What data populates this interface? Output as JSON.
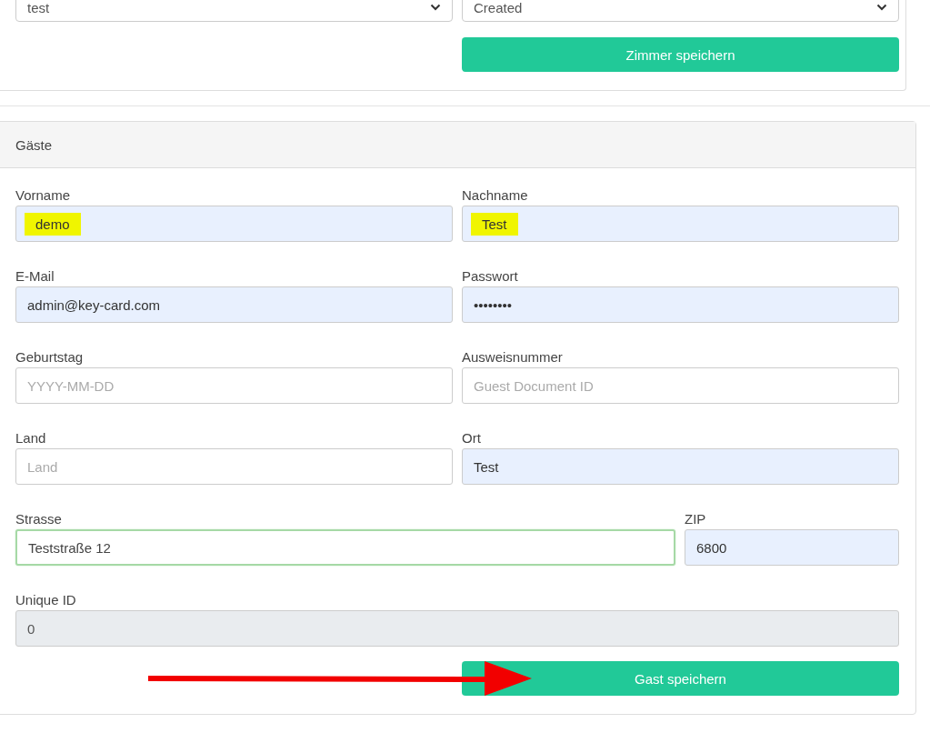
{
  "room_form": {
    "selects": [
      {
        "value": "test"
      },
      {
        "value": "Created"
      }
    ],
    "save_button": "Zimmer speichern"
  },
  "guests": {
    "title": "Gäste",
    "rows": [
      {
        "fields": [
          {
            "label": "Vorname",
            "value": "demo",
            "kind": "autofilled",
            "highlighted": true
          },
          {
            "label": "Nachname",
            "value": "Test",
            "kind": "autofilled",
            "highlighted": true
          }
        ]
      },
      {
        "fields": [
          {
            "label": "E-Mail",
            "value": "admin@key-card.com",
            "kind": "autofilled",
            "highlighted": false
          },
          {
            "label": "Passwort",
            "value": "••••••••",
            "kind": "autofilled",
            "highlighted": false
          }
        ]
      },
      {
        "fields": [
          {
            "label": "Geburtstag",
            "placeholder": "YYYY-MM-DD",
            "kind": "empty",
            "highlighted": false
          },
          {
            "label": "Ausweisnummer",
            "placeholder": "Guest Document ID",
            "kind": "empty",
            "highlighted": false
          }
        ]
      },
      {
        "fields": [
          {
            "label": "Land",
            "placeholder": "Land",
            "kind": "empty",
            "highlighted": false
          },
          {
            "label": "Ort",
            "value": "Test",
            "kind": "autofilled",
            "highlighted": false
          }
        ]
      },
      {
        "fields": [
          {
            "label": "Strasse",
            "value": "Teststraße 12",
            "kind": "focused",
            "highlighted": false
          },
          {
            "label": "ZIP",
            "value": "6800",
            "kind": "autofilled",
            "highlighted": false
          }
        ]
      },
      {
        "fields": [
          {
            "label": "Unique ID",
            "value": "0",
            "kind": "disabled",
            "highlighted": false
          }
        ]
      }
    ],
    "save_button": "Gast speichern"
  }
}
